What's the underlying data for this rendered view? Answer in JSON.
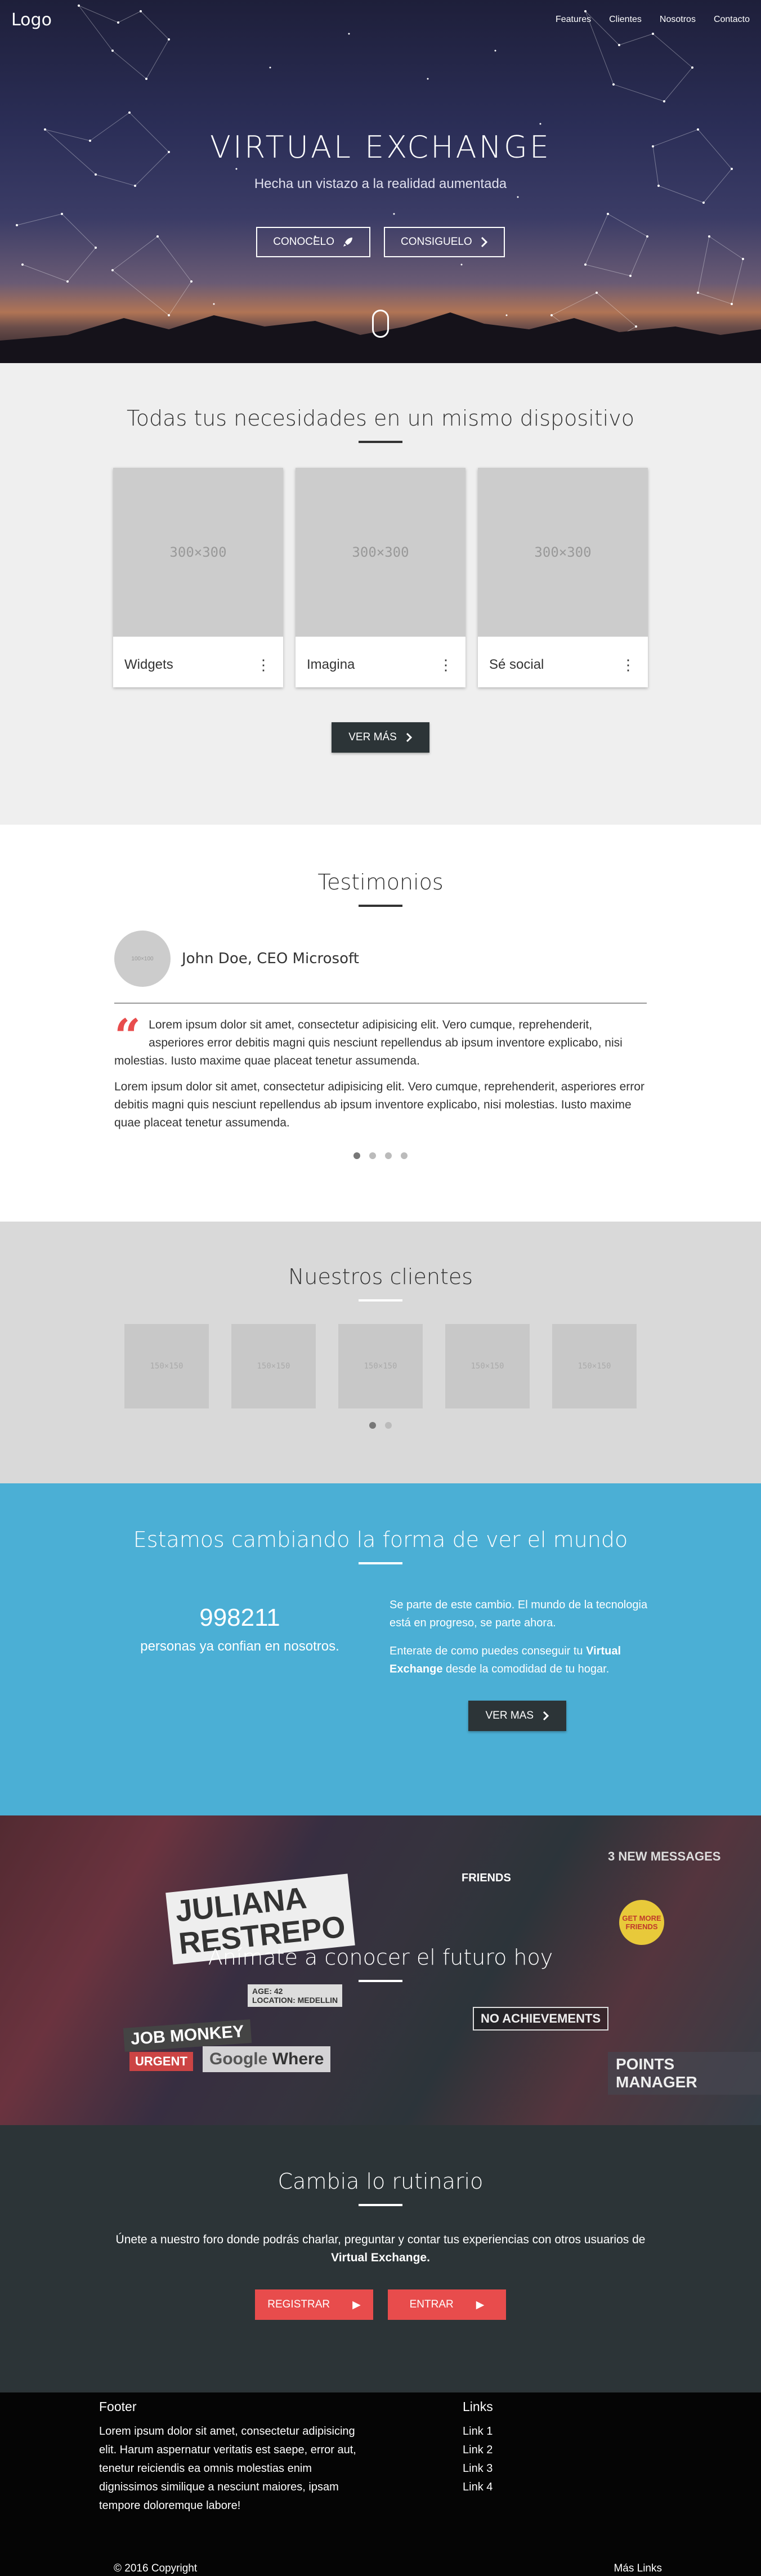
{
  "nav": {
    "logo": "Logo",
    "links": [
      "Features",
      "Clientes",
      "Nosotros",
      "Contacto"
    ]
  },
  "hero": {
    "title": "VIRTUAL EXCHANGE",
    "subtitle": "Hecha un vistazo a la realidad aumentada",
    "button_primary": "CONOCELO",
    "button_secondary": "CONSIGUELO",
    "icons": {
      "primary": "rocket-icon",
      "secondary": "chevron-right-icon",
      "scroll": "mouse-scroll-icon"
    }
  },
  "needs": {
    "title": "Todas tus necesidades en un mismo dispositivo",
    "cards": [
      {
        "image_label": "300×300",
        "title": "Widgets"
      },
      {
        "image_label": "300×300",
        "title": "Imagina"
      },
      {
        "image_label": "300×300",
        "title": "Sé social"
      }
    ],
    "menu_icon": "more-vert-icon",
    "button": "VER MÁS"
  },
  "testimonials": {
    "title": "Testimonios",
    "avatar_label": "100×100",
    "name": "John Doe, CEO Microsoft",
    "quote_icon": "quote-icon",
    "paragraphs": [
      "Lorem ipsum dolor sit amet, consectetur adipisicing elit. Vero cumque, reprehenderit, asperiores error debitis magni quis nesciunt repellendus ab ipsum inventore explicabo, nisi molestias. Iusto maxime quae placeat tenetur assumenda.",
      "Lorem ipsum dolor sit amet, consectetur adipisicing elit. Vero cumque, reprehenderit, asperiores error debitis magni quis nesciunt repellendus ab ipsum inventore explicabo, nisi molestias. Iusto maxime quae placeat tenetur assumenda."
    ],
    "dots": 4,
    "active_dot": 0
  },
  "clients": {
    "title": "Nuestros clientes",
    "logos": [
      "150×150",
      "150×150",
      "150×150",
      "150×150",
      "150×150"
    ],
    "dots": 2,
    "active_dot": 0
  },
  "stats": {
    "title": "Estamos cambiando la forma de ver el mundo",
    "number": "998211",
    "label": "personas ya confian en nosotros.",
    "paragraph1": "Se parte de este cambio. El mundo de la tecnologia está en progreso, se parte ahora.",
    "paragraph2_pre": "Enterate de como puedes conseguir tu ",
    "paragraph2_bold": "Virtual Exchange",
    "paragraph2_post": " desde la comodidad de tu hogar.",
    "button": "VER MAS"
  },
  "future": {
    "title": "Anímate a conocer el futuro hoy",
    "image_text": {
      "name_line1": "JULIANA",
      "name_line2": "RESTREPO",
      "job": "JOB MONKEY",
      "urgent": "URGENT",
      "friends": "FRIENDS",
      "achievements": "NO ACHIEVEMENTS",
      "points": "POINTS MANAGER",
      "get_more": "GET MORE FRIENDS",
      "google": "Google",
      "where": "Where",
      "new_messages": "3 NEW MESSAGES",
      "age": "AGE: 42",
      "location": "LOCATION: MEDELLIN"
    }
  },
  "routine": {
    "title": "Cambia lo rutinario",
    "text_pre": "Únete a nuestro foro donde podrás charlar, preguntar y contar tus experiencias con otros usuarios de ",
    "text_bold": "Virtual Exchange.",
    "button_register": "REGISTRAR",
    "button_enter": "ENTRAR"
  },
  "footer": {
    "title": "Footer",
    "text": "Lorem ipsum dolor sit amet, consectetur adipisicing elit. Harum aspernatur veritatis est saepe, error aut, tenetur reiciendis ea omnis molestias enim dignissimos similique a nesciunt maiores, ipsam tempore doloremque labore!",
    "links_title": "Links",
    "links": [
      "Link 1",
      "Link 2",
      "Link 3",
      "Link 4"
    ],
    "copyright": "© 2016 Copyright",
    "more_links": "Más Links"
  }
}
